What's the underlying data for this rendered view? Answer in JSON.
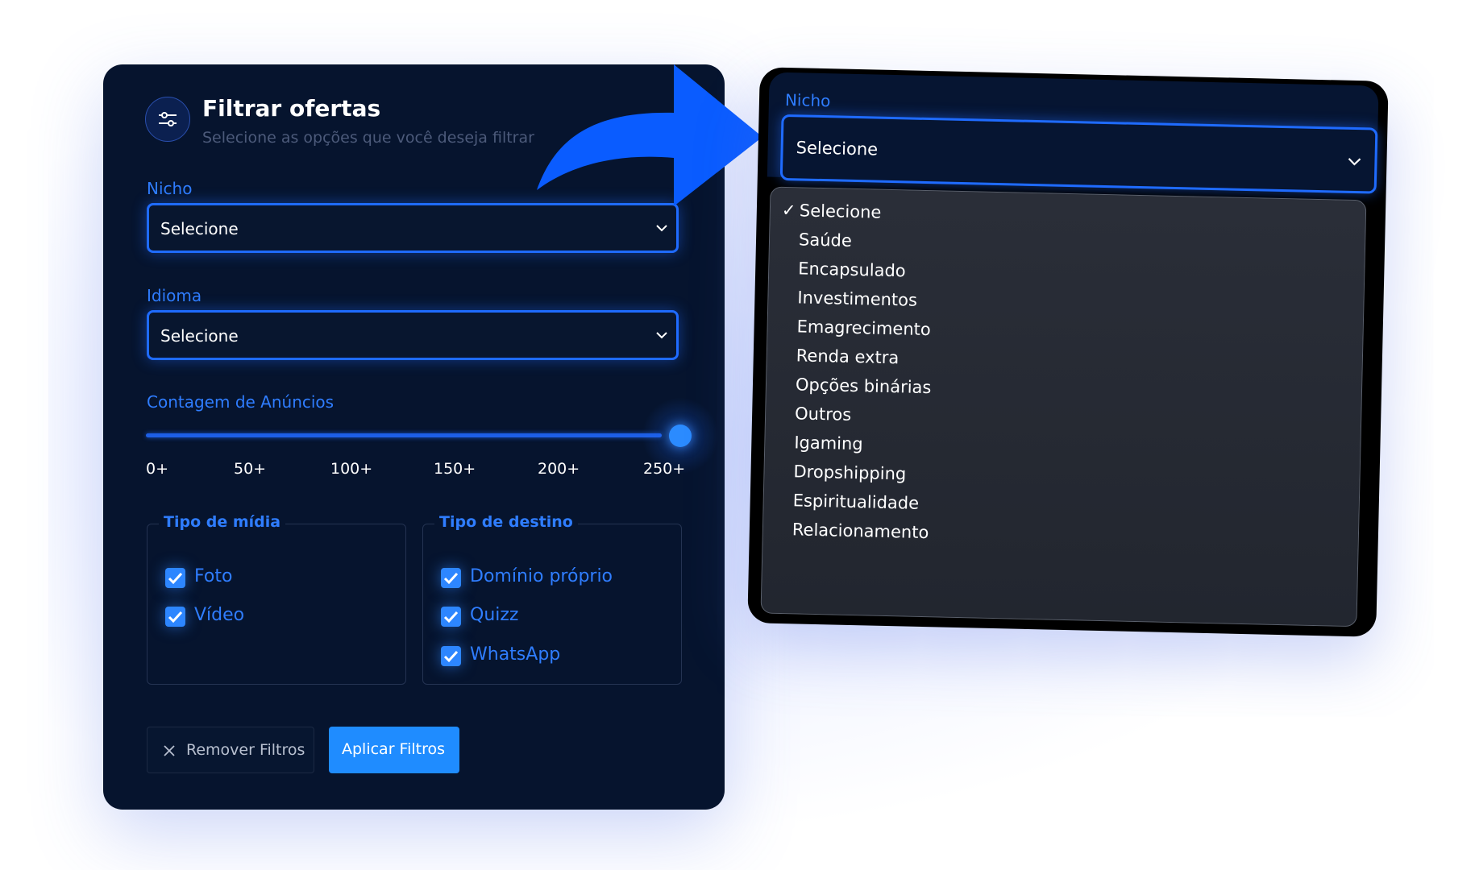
{
  "header": {
    "icon": "sliders-icon",
    "title": "Filtrar ofertas",
    "subtitle": "Selecione as opções que você deseja filtrar"
  },
  "nicho": {
    "label": "Nicho",
    "value": "Selecione"
  },
  "idioma": {
    "label": "Idioma",
    "value": "Selecione"
  },
  "ads_count": {
    "label": "Contagem de Anúncios",
    "ticks": [
      "0+",
      "50+",
      "100+",
      "150+",
      "200+",
      "250+"
    ],
    "value_fraction": 1.0
  },
  "media_type": {
    "legend": "Tipo de mídia",
    "options": [
      {
        "label": "Foto",
        "checked": true
      },
      {
        "label": "Vídeo",
        "checked": true
      }
    ]
  },
  "destination_type": {
    "legend": "Tipo de destino",
    "options": [
      {
        "label": "Domínio próprio",
        "checked": true
      },
      {
        "label": "Quizz",
        "checked": true
      },
      {
        "label": "WhatsApp",
        "checked": true
      }
    ]
  },
  "buttons": {
    "remove": "Remover Filtros",
    "apply": "Aplicar Filtros"
  },
  "dropdown": {
    "label": "Nicho",
    "value": "Selecione",
    "check_mark": "✓",
    "options": [
      "Selecione",
      "Saúde",
      "Encapsulado",
      "Investimentos",
      "Emagrecimento",
      "Renda extra",
      "Opções binárias",
      "Outros",
      "Igaming",
      "Dropshipping",
      "Espiritualidade",
      "Relacionamento"
    ],
    "selected_index": 0
  },
  "colors": {
    "panel_bg": "#06142e",
    "accent": "#1f6bff",
    "label_blue": "#2f7dff",
    "apply_button": "#1f8cff",
    "dropdown_bg": "#2a2e38"
  }
}
